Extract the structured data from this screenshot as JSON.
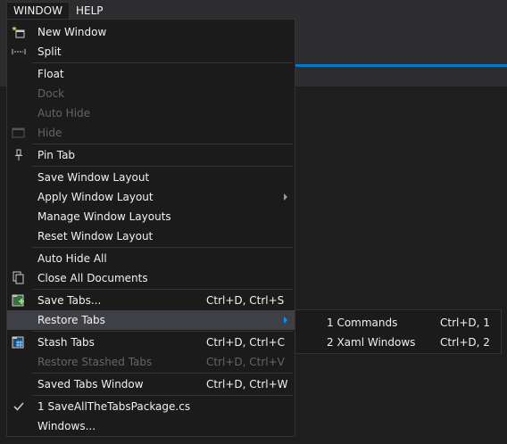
{
  "menubar": {
    "items": [
      {
        "label": "WINDOW"
      },
      {
        "label": "HELP"
      }
    ]
  },
  "menu": {
    "new_window": "New Window",
    "split": "Split",
    "float": "Float",
    "dock": "Dock",
    "auto_hide": "Auto Hide",
    "hide": "Hide",
    "pin_tab": "Pin Tab",
    "save_window_layout": "Save Window Layout",
    "apply_window_layout": "Apply Window Layout",
    "manage_window_layouts": "Manage Window Layouts",
    "reset_window_layout": "Reset Window Layout",
    "auto_hide_all": "Auto Hide All",
    "close_all_documents": "Close All Documents",
    "save_tabs": {
      "label": "Save Tabs...",
      "shortcut": "Ctrl+D, Ctrl+S"
    },
    "restore_tabs": "Restore Tabs",
    "stash_tabs": {
      "label": "Stash Tabs",
      "shortcut": "Ctrl+D, Ctrl+C"
    },
    "restore_stashed_tabs": {
      "label": "Restore Stashed Tabs",
      "shortcut": "Ctrl+D, Ctrl+V"
    },
    "saved_tabs_window": {
      "label": "Saved Tabs Window",
      "shortcut": "Ctrl+D, Ctrl+W"
    },
    "recent_1": "1 SaveAllTheTabsPackage.cs",
    "windows": "Windows..."
  },
  "submenu": {
    "items": [
      {
        "label": "1 Commands",
        "shortcut": "Ctrl+D, 1"
      },
      {
        "label": "2 Xaml Windows",
        "shortcut": "Ctrl+D, 2"
      }
    ]
  },
  "colors": {
    "accent": "#007acc",
    "menu_bg": "#1b1b1c",
    "highlight": "#3f3f46",
    "disabled_text": "#656565"
  },
  "icons": {
    "new_window": "new-window-icon",
    "split": "split-icon",
    "hide": "hide-icon",
    "pin_tab": "pin-icon",
    "close_all_documents": "close-all-documents-icon",
    "save_tabs": "save-tabs-icon",
    "stash_tabs": "stash-tabs-icon",
    "recent_1": "checkmark-icon"
  }
}
